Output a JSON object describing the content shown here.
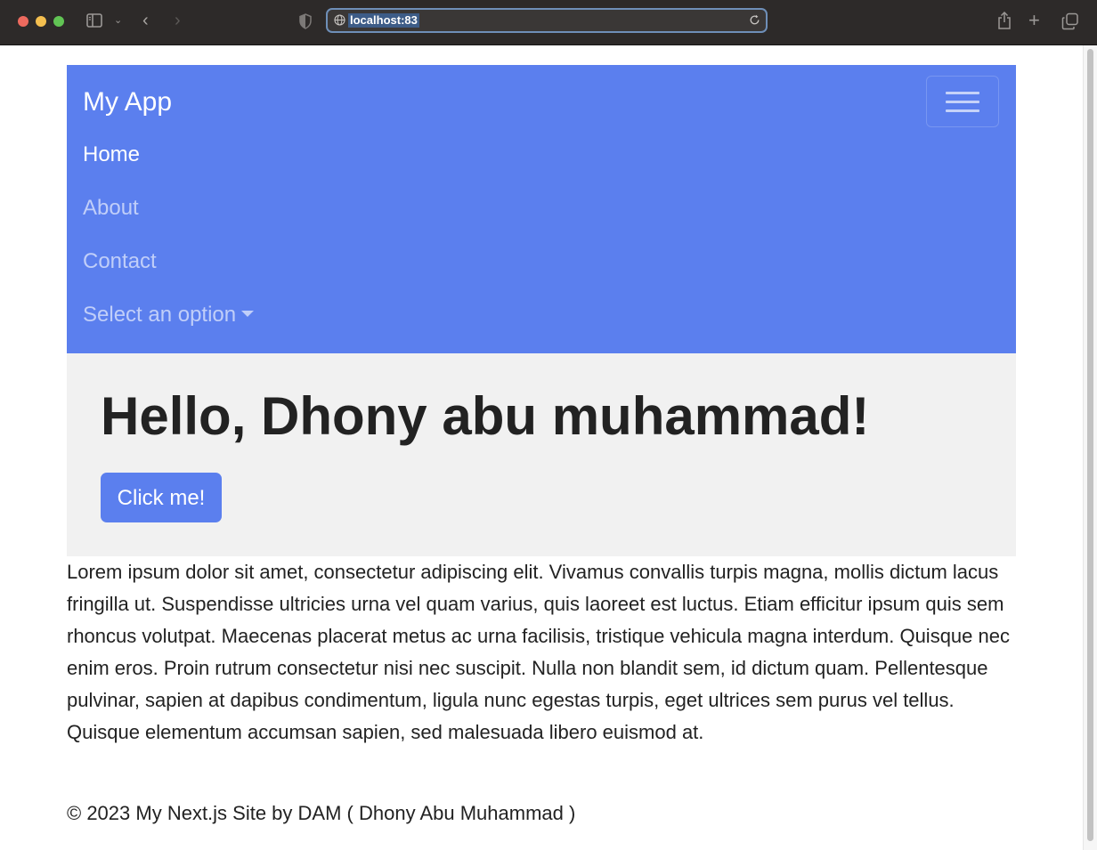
{
  "browser": {
    "url": "localhost:83"
  },
  "navbar": {
    "brand": "My App",
    "links": [
      "Home",
      "About",
      "Contact"
    ],
    "dropdown_label": "Select an option"
  },
  "hero": {
    "heading": "Hello, Dhony abu muhammad!",
    "button_label": "Click me!"
  },
  "content": {
    "paragraph": "Lorem ipsum dolor sit amet, consectetur adipiscing elit. Vivamus convallis turpis magna, mollis dictum lacus fringilla ut. Suspendisse ultricies urna vel quam varius, quis laoreet est luctus. Etiam efficitur ipsum quis sem rhoncus volutpat. Maecenas placerat metus ac urna facilisis, tristique vehicula magna interdum. Quisque nec enim eros. Proin rutrum consectetur nisi nec suscipit. Nulla non blandit sem, id dictum quam. Pellentesque pulvinar, sapien at dapibus condimentum, ligula nunc egestas turpis, eget ultrices sem purus vel tellus. Quisque elementum accumsan sapien, sed malesuada libero euismod at."
  },
  "footer": {
    "text": "© 2023 My Next.js Site by DAM ( Dhony Abu Muhammad )"
  },
  "colors": {
    "primary": "#5b7fee",
    "hero_bg": "#f1f1f1",
    "text": "#222222"
  }
}
